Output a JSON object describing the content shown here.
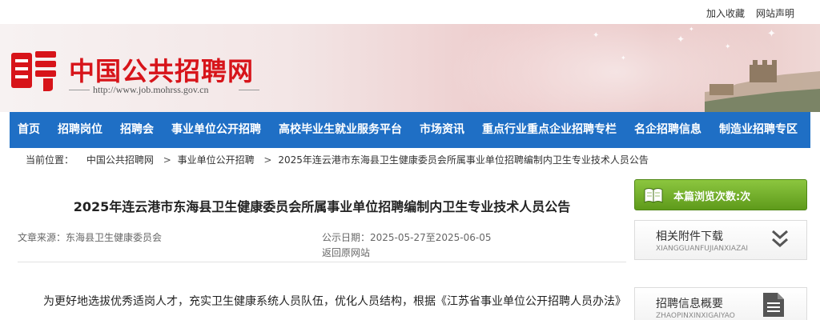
{
  "topbar": {
    "favorite": "加入收藏",
    "statement": "网站声明"
  },
  "header": {
    "site_title": "中国公共招聘网",
    "site_url": "http://www.job.mohrss.gov.cn",
    "logo": "pin-logo-icon"
  },
  "nav": [
    "首页",
    "招聘岗位",
    "招聘会",
    "事业单位公开招聘",
    "高校毕业生就业服务平台",
    "市场资讯",
    "重点行业重点企业招聘专栏",
    "名企招聘信息",
    "制造业招聘专区"
  ],
  "breadcrumb": {
    "label": "当前位置：",
    "items": [
      "中国公共招聘网",
      "事业单位公开招聘",
      "2025年连云港市东海县卫生健康委员会所属事业单位招聘编制内卫生专业技术人员公告"
    ],
    "separator": ">"
  },
  "article": {
    "title": "2025年连云港市东海县卫生健康委员会所属事业单位招聘编制内卫生专业技术人员公告",
    "source_label": "文章来源：",
    "source": "东海县卫生健康委员会",
    "date_label": "公示日期：",
    "date": "2025-05-27至2025-06-05",
    "back_link": "返回原网站",
    "body": "为更好地选拔优秀适岗人才，充实卫生健康系统人员队伍，优化人员结构，根据《江苏省事业单位公开招聘人员办法》"
  },
  "sidebar": {
    "views": "本篇浏览次数:次",
    "cards": [
      {
        "title": "相关附件下载",
        "subtitle": "XIANGGUANFUJIANXIAZAI",
        "icon": "double-chevron-down-icon"
      },
      {
        "title": "招聘信息概要",
        "subtitle": "ZHAOPINXINXIGAIYAO",
        "icon": "document-icon"
      }
    ]
  },
  "colors": {
    "nav_bg": "#1f6fc5",
    "brand_red": "#d7141a",
    "views_green": "#6fae28"
  }
}
